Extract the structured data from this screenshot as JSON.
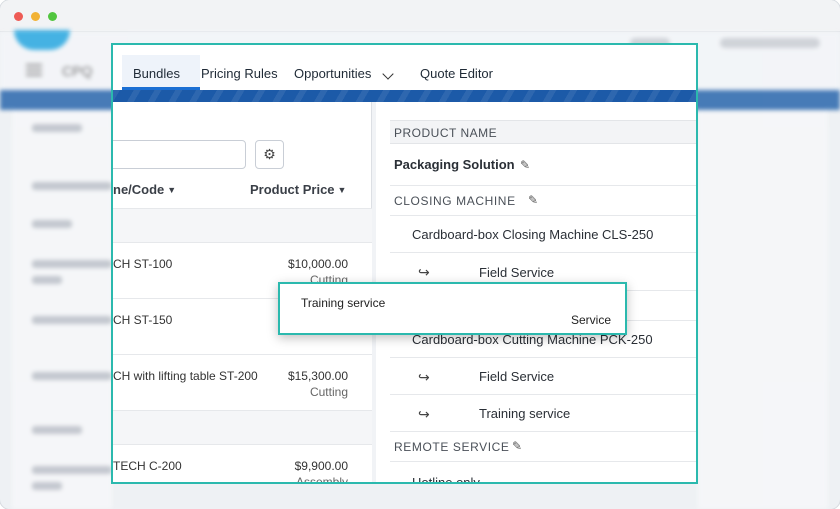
{
  "window": {
    "controls": [
      "close",
      "minimize",
      "maximize"
    ]
  },
  "background": {
    "app_name": "CPQ"
  },
  "tabs": [
    {
      "label": "Bundles",
      "active": true
    },
    {
      "label": "Pricing Rules"
    },
    {
      "label": "Opportunities",
      "has_dropdown": true
    },
    {
      "label": "Quote Editor"
    }
  ],
  "left_panel": {
    "search": {
      "value": "",
      "placeholder": ""
    },
    "settings_icon": "gear-icon",
    "columns": {
      "name": "Product Name/Code",
      "name_visible": "ne/Code",
      "price": "Product Price"
    },
    "products": [
      {
        "name": "CH ST-100",
        "price": "$10,000.00",
        "category": "Cutting"
      },
      {
        "name": "CH ST-150",
        "price": "",
        "category": ""
      },
      {
        "name": "CH with lifting table ST-200",
        "price": "$15,300.00",
        "category": "Cutting"
      },
      {
        "name": "TECH C-200",
        "price": "$9,900.00",
        "category": "Assembly"
      }
    ]
  },
  "right_panel": {
    "header": "PRODUCT NAME",
    "bundle_name": "Packaging Solution",
    "sections": [
      {
        "title": "CLOSING MACHINE",
        "item": "Cardboard-box Closing Machine CLS-250",
        "services": [
          "Field Service"
        ]
      },
      {
        "title": "",
        "item": "Cardboard-box Cutting Machine PCK-250",
        "services": [
          "Field Service",
          "Training service"
        ]
      },
      {
        "title": "REMOTE SERVICE",
        "item": "Hotline only",
        "services": []
      }
    ]
  },
  "tooltip": {
    "title": "Training service",
    "type": "Service"
  },
  "colors": {
    "accent": "#2bb9ae",
    "brand_band": "#1c5aa8",
    "active_tab": "#1b6fd3"
  }
}
